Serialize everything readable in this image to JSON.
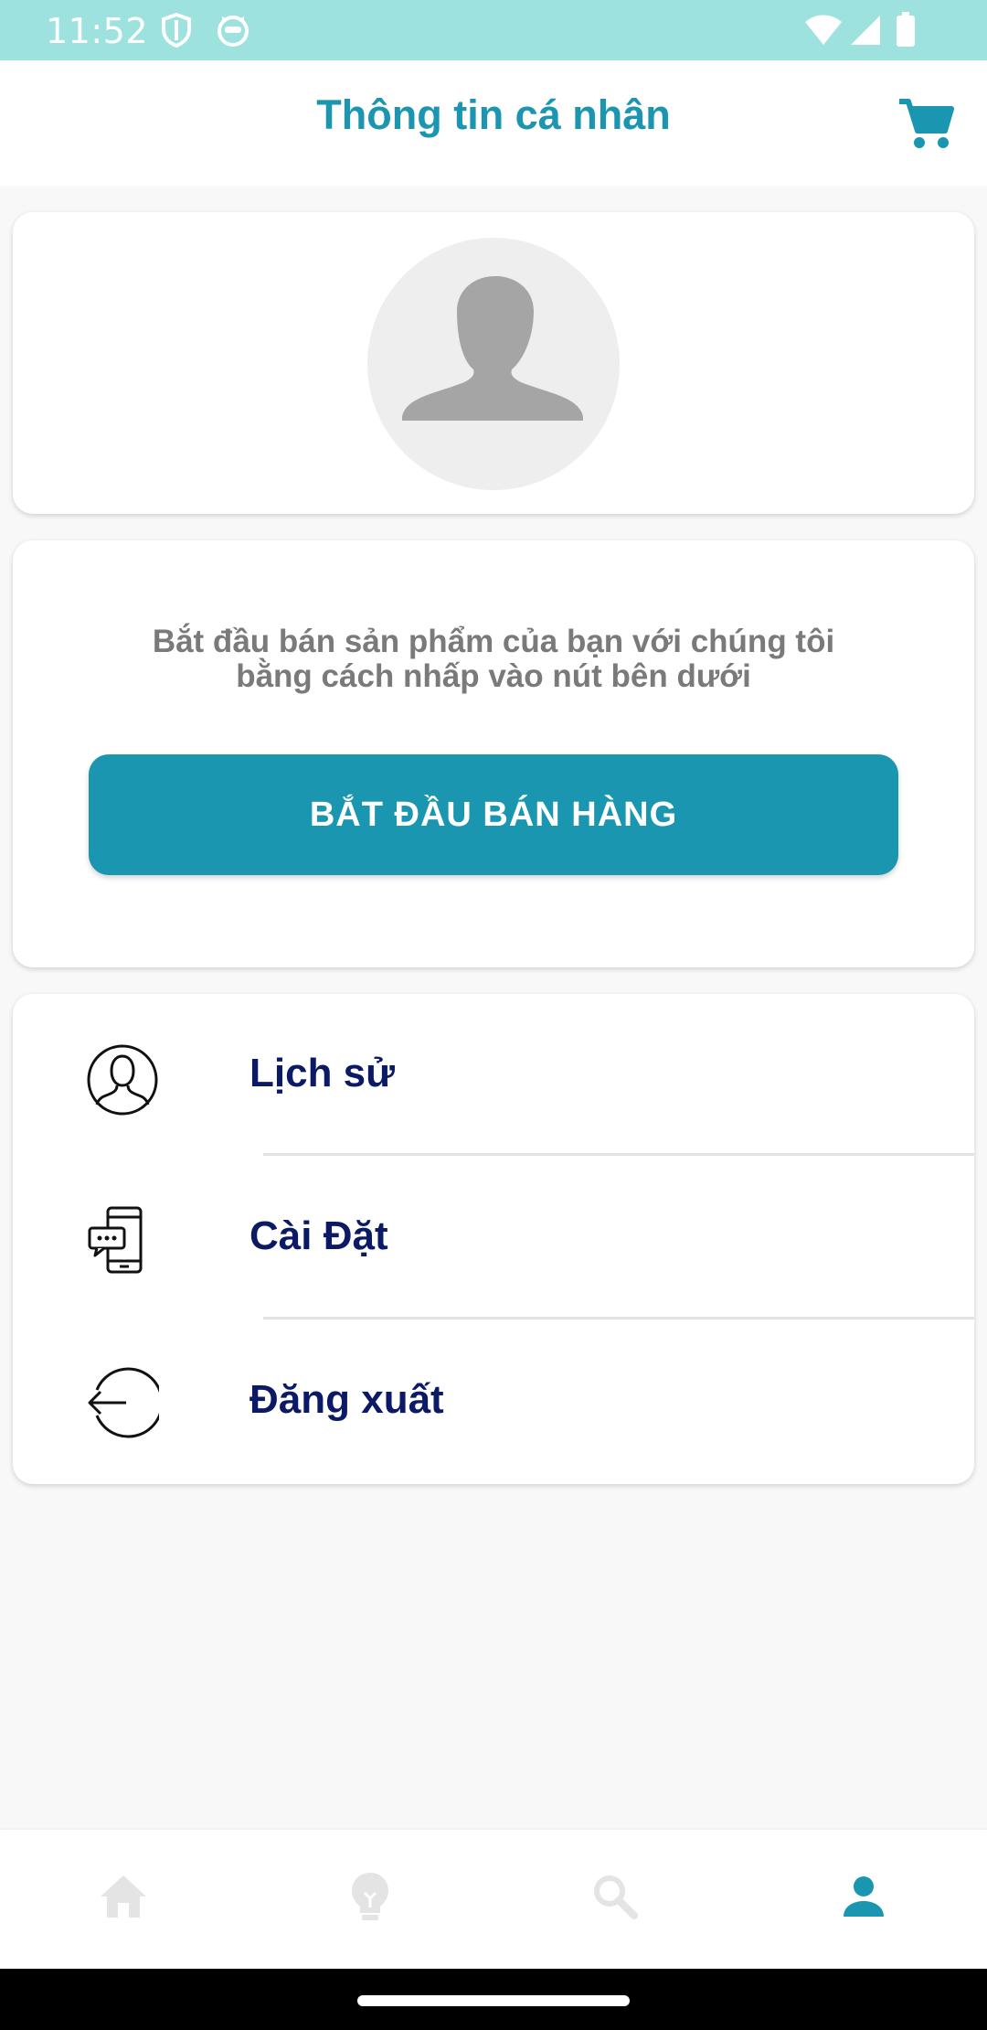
{
  "status_bar": {
    "time": "11:52"
  },
  "header": {
    "title": "Thông tin cá nhân",
    "cart_icon": "cart-icon"
  },
  "profile": {
    "avatar_icon": "avatar-placeholder-icon"
  },
  "sell": {
    "description_line1": "Bắt đầu bán sản phẩm của bạn với chúng tôi",
    "description_line2": "bằng cách nhấp vào nút bên dưới",
    "button_label": "BẮT ĐẦU BÁN HÀNG"
  },
  "menu": {
    "items": [
      {
        "label": "Lịch sử",
        "icon": "user-outline-icon"
      },
      {
        "label": "Cài Đặt",
        "icon": "phone-chat-icon"
      },
      {
        "label": "Đăng xuất",
        "icon": "logout-icon"
      }
    ]
  },
  "bottom_nav": {
    "items": [
      {
        "name": "home",
        "icon": "home-icon",
        "active": false
      },
      {
        "name": "ideas",
        "icon": "lightbulb-icon",
        "active": false
      },
      {
        "name": "search",
        "icon": "search-icon",
        "active": false
      },
      {
        "name": "profile",
        "icon": "person-icon",
        "active": true
      }
    ]
  },
  "colors": {
    "accent": "#1a96b0",
    "status_bar": "#9de2df",
    "menu_text": "#0c1a66",
    "inactive_icon": "#e4e4e4"
  }
}
